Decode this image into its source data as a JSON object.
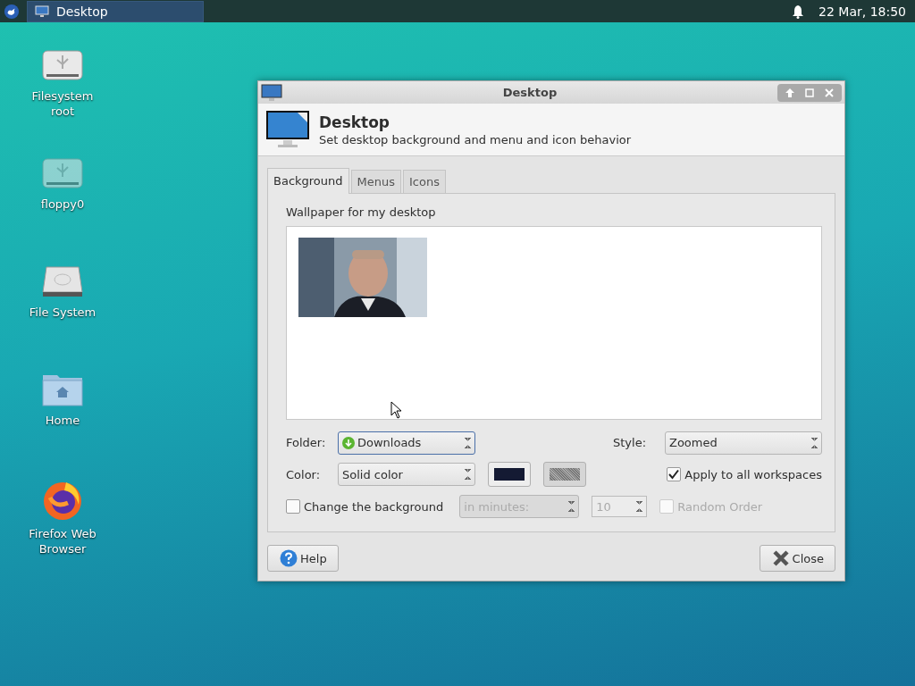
{
  "taskbar": {
    "window_button": {
      "title": "Desktop",
      "selected": true
    },
    "clock": "22 Mar, 18:50"
  },
  "desktop_icons": [
    {
      "label": "Filesystem root",
      "kind": "usb"
    },
    {
      "label": "floppy0",
      "kind": "floppy"
    },
    {
      "label": "File System",
      "kind": "disk"
    },
    {
      "label": "Home",
      "kind": "folder"
    },
    {
      "label": "Firefox Web Browser",
      "kind": "browser"
    }
  ],
  "dialog": {
    "title": "Desktop",
    "header": {
      "title": "Desktop",
      "subtitle": "Set desktop background and menu and icon behavior"
    },
    "tabs": [
      {
        "label": "Background",
        "selected": true
      },
      {
        "label": "Menus",
        "selected": false
      },
      {
        "label": "Icons",
        "selected": false
      }
    ],
    "wallpaper_label": "Wallpaper for my desktop",
    "folder": {
      "label": "Folder:",
      "value": "Downloads"
    },
    "style": {
      "label": "Style:",
      "value": "Zoomed"
    },
    "color": {
      "label": "Color:",
      "value": "Solid color"
    },
    "apply_all": {
      "label": "Apply to all workspaces",
      "checked": true
    },
    "change_background": {
      "label": "Change the background",
      "checked": false
    },
    "interval": {
      "value": "in minutes:",
      "disabled": true
    },
    "interval_count": {
      "value": "10",
      "disabled": true
    },
    "random_order": {
      "label": "Random Order",
      "checked": false,
      "disabled": true
    },
    "buttons": [
      {
        "label": "Help",
        "kind": "help"
      },
      {
        "label": "Close",
        "kind": "close"
      }
    ]
  }
}
